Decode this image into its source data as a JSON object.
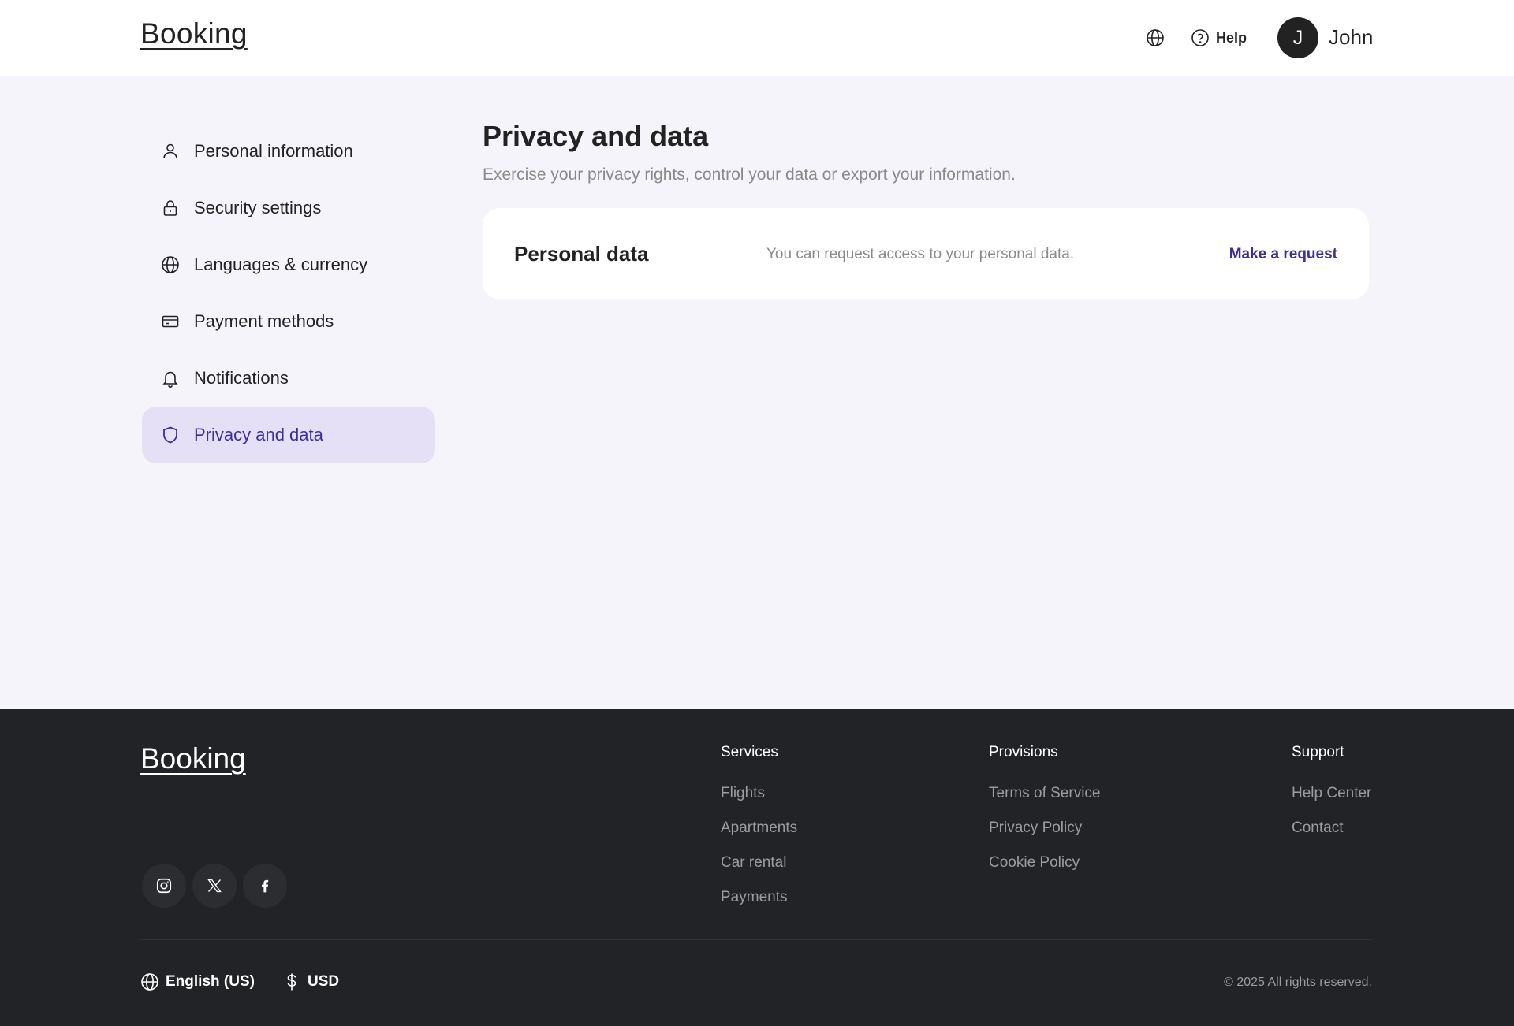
{
  "header": {
    "logo": "Booking",
    "help_label": "Help",
    "avatar_initial": "J",
    "user_name": "John"
  },
  "sidebar": {
    "items": [
      {
        "label": "Personal information",
        "icon": "user-icon"
      },
      {
        "label": "Security settings",
        "icon": "lock-icon"
      },
      {
        "label": "Languages & currency",
        "icon": "globe-icon"
      },
      {
        "label": "Payment methods",
        "icon": "card-icon"
      },
      {
        "label": "Notifications",
        "icon": "bell-icon"
      },
      {
        "label": "Privacy and data",
        "icon": "shield-icon",
        "active": true
      }
    ]
  },
  "main": {
    "title": "Privacy and data",
    "subtitle": "Exercise your privacy rights, control your data or export your information.",
    "card": {
      "title": "Personal data",
      "text": "You can request access to your personal data.",
      "link": "Make a request"
    }
  },
  "footer": {
    "logo": "Booking",
    "social": [
      "instagram-icon",
      "x-icon",
      "facebook-icon"
    ],
    "columns": [
      {
        "heading": "Services",
        "links": [
          "Flights",
          "Apartments",
          "Car rental",
          "Payments"
        ]
      },
      {
        "heading": "Provisions",
        "links": [
          "Terms of Service",
          "Privacy Policy",
          "Cookie Policy"
        ]
      },
      {
        "heading": "Support",
        "links": [
          "Help Center",
          "Contact"
        ]
      }
    ],
    "language": "English (US)",
    "currency": "USD",
    "copyright": "© 2025 All rights reserved."
  },
  "colors": {
    "accent": "#3d2f9a",
    "active_bg": "#e5e0f5",
    "page_bg": "#f6f4fb",
    "footer_bg": "#212326"
  }
}
